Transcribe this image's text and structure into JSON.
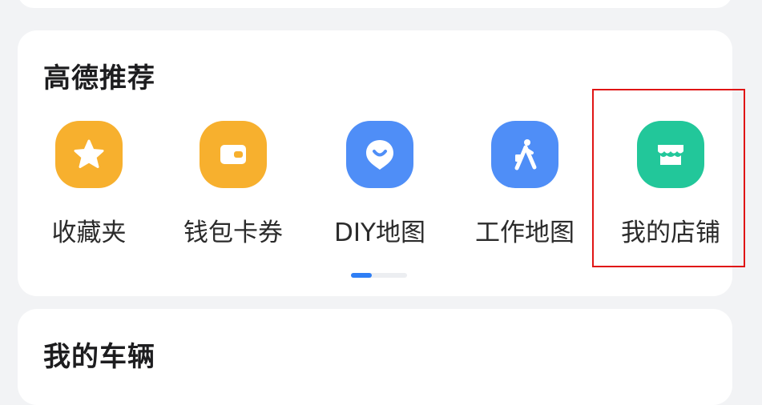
{
  "sections": {
    "recommend": {
      "title": "高德推荐",
      "items": [
        {
          "label": "收藏夹",
          "icon": "star-icon",
          "color": "#f7b02e"
        },
        {
          "label": "钱包卡券",
          "icon": "wallet-icon",
          "color": "#f7b02e"
        },
        {
          "label": "DIY地图",
          "icon": "map-pin-smile-icon",
          "color": "#4f8ef7"
        },
        {
          "label": "工作地图",
          "icon": "walking-person-icon",
          "color": "#4f8ef7"
        },
        {
          "label": "我的店铺",
          "icon": "store-icon",
          "color": "#22c79a"
        }
      ],
      "pager": {
        "active_color": "#2e7ef5"
      }
    },
    "vehicles": {
      "title": "我的车辆"
    }
  },
  "highlight": {
    "color": "#e01515"
  }
}
